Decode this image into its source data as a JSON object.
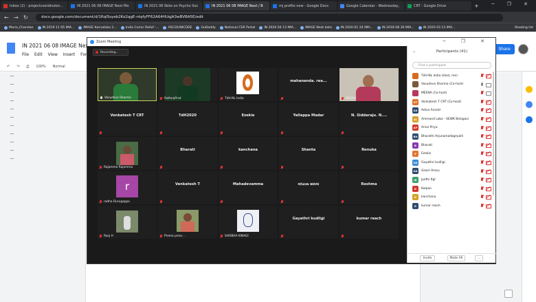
{
  "browser": {
    "tabs": [
      {
        "title": "Inbox (2) - projectcoordinator...",
        "color": "#d93025",
        "active": false
      },
      {
        "title": "IN 2021 06 08 IMAGE Next Mo",
        "color": "#1a73e8",
        "active": false
      },
      {
        "title": "IN 2021 06 Note on Psycho Soc",
        "color": "#1a73e8",
        "active": false
      },
      {
        "title": "IN 2021 06 08 IMAGE Next / B",
        "color": "#1a73e8",
        "active": true
      },
      {
        "title": "mj profile new - Google Docs",
        "color": "#1a73e8",
        "active": false
      },
      {
        "title": "Google Calendar - Wednesday,",
        "color": "#4285f4",
        "active": false
      },
      {
        "title": "CRT - Google Drive",
        "color": "#0f9d58",
        "active": false
      }
    ],
    "new_tab": "+",
    "url": "docs.google.com/document/d/1RqlSsyeb2Ko2qgE-ntqfyFF62A64HUqjA3wBVBA5E/edit",
    "bookmarks": [
      "Maria_Chandan",
      "IN 2019 11 05 IMA...",
      "IMAGE Karnataka 2...",
      "India Comic Relief -...",
      "ASCI2UNICODE",
      "GoDaddy",
      "National CSR Portal",
      "IN 2020 04 13 IMA...",
      "IMAGE Next data",
      "IN 2020-01 24 IMA...",
      "IN 2018 08 30 IMA...",
      "IN 2020 03 13 IMA..."
    ],
    "reading_list": "Reading list",
    "system_time": "11:12",
    "system_date": "09-06-2021",
    "system_lang": "ENG"
  },
  "docs": {
    "title": "IN 2021 06 08 IMAGE Next",
    "menu": [
      "File",
      "Edit",
      "View",
      "Insert",
      "Forma"
    ],
    "zoom": "100%",
    "style": "Normal",
    "share_label": "Share"
  },
  "zoom": {
    "window_title": "Zoom Meeting",
    "recording_label": "Recording...",
    "tiles": [
      {
        "id": "vasudeva",
        "type": "video",
        "label": "Vasudeva Sharma",
        "mic": "on",
        "active": true
      },
      {
        "id": "rathnaprasad",
        "type": "video",
        "label": "RathnaPrsd",
        "mic": "off"
      },
      {
        "id": "tdh",
        "type": "logo",
        "label": "TdH-NL India",
        "mic": "off"
      },
      {
        "id": "mahananda",
        "type": "name",
        "name": "mahananda. rea...",
        "mic": "off"
      },
      {
        "id": "meena",
        "type": "video",
        "label": "MEENA",
        "mic": "off"
      },
      {
        "id": "venkatesh-crt",
        "type": "name",
        "name": "Venkatesh T CRT",
        "mic": "off"
      },
      {
        "id": "tdh2020",
        "type": "name",
        "name": "TdH2020",
        "mic": "off"
      },
      {
        "id": "ezekie",
        "type": "name",
        "name": "Ezekie",
        "mic": "off"
      },
      {
        "id": "yallappa",
        "type": "name",
        "name": "Yallappa Madar",
        "mic": "off"
      },
      {
        "id": "siddaraju",
        "type": "name",
        "name": "N. Siddaraju. N....",
        "mic": "off"
      },
      {
        "id": "rajamma",
        "type": "video",
        "label": "Rajamma Rajamma",
        "mic": "off"
      },
      {
        "id": "bharati",
        "type": "name",
        "name": "Bharati",
        "mic": "off"
      },
      {
        "id": "kanchana",
        "type": "name",
        "name": "kanchana",
        "mic": "off"
      },
      {
        "id": "shanta",
        "type": "name",
        "name": "Shanta",
        "mic": "off"
      },
      {
        "id": "renuka",
        "type": "name",
        "name": "Renuka",
        "mic": "off"
      },
      {
        "id": "radha",
        "type": "avatar",
        "letter": "r",
        "label": "radha Durugappa",
        "mic": "off"
      },
      {
        "id": "venkatesh-t",
        "type": "name",
        "name": "Venkatesh T",
        "mic": "off"
      },
      {
        "id": "mahadevamma",
        "type": "name",
        "name": "Mahadevamma",
        "mic": "off"
      },
      {
        "id": "kannada",
        "type": "name",
        "name": "ಸರೋಜಾ ಹವಳದ",
        "mic": "off"
      },
      {
        "id": "reshma",
        "type": "name",
        "name": "Reshma",
        "mic": "off"
      },
      {
        "id": "rooj",
        "type": "video",
        "label": "Rooj H",
        "mic": "off"
      },
      {
        "id": "prema",
        "type": "video",
        "label": "Prema pmor...",
        "mic": "off"
      },
      {
        "id": "shobha",
        "type": "video",
        "label": "SHOBHA KINAGI",
        "mic": "off"
      },
      {
        "id": "gayathri",
        "type": "name",
        "name": "Gayathri kudligi",
        "mic": "off"
      },
      {
        "id": "kumar",
        "type": "name",
        "name": "kumar reach",
        "mic": "off"
      }
    ],
    "participants": {
      "title": "Participants (41)",
      "search_placeholder": "Find a participant",
      "list": [
        {
          "initials": "",
          "name": "TdH-NL India (Host, me)",
          "color": "#d86a1e",
          "mic": "off",
          "cam": "off"
        },
        {
          "initials": "",
          "name": "Vasudeva Sharma (Co-host)",
          "color": "#7a5a3a",
          "mic": "on",
          "cam": "on"
        },
        {
          "initials": "",
          "name": "MEENA (Co-host)",
          "color": "#b33a5a",
          "mic": "off",
          "cam": "on"
        },
        {
          "initials": "VT",
          "name": "Venkatesh T CRT (Co-host)",
          "color": "#e0742d",
          "mic": "off",
          "cam": "off"
        },
        {
          "initials": "AA",
          "name": "Adiva Arnold",
          "color": "#2e4b6e",
          "mic": "off",
          "cam": "off"
        },
        {
          "initials": "AL",
          "name": "Ammand Lobo - SEWK Belagavi",
          "color": "#d6a128",
          "mic": "off",
          "cam": "off"
        },
        {
          "initials": "AP",
          "name": "Anne Priya",
          "color": "#d33a2a",
          "mic": "off",
          "cam": "off"
        },
        {
          "initials": "BA",
          "name": "Bharathi Arjunamallageyalli",
          "color": "#2e4b6e",
          "mic": "off",
          "cam": "off"
        },
        {
          "initials": "B",
          "name": "Bharati",
          "color": "#8a3ab0",
          "mic": "off",
          "cam": "off"
        },
        {
          "initials": "E",
          "name": "Ezekie",
          "color": "#e0742d",
          "mic": "off",
          "cam": "off"
        },
        {
          "initials": "GK",
          "name": "Gayathri kudligi",
          "color": "#3a8ad6",
          "mic": "off",
          "cam": "off"
        },
        {
          "initials": "GA",
          "name": "Gowri Arasu",
          "color": "#2e4b6e",
          "mic": "off",
          "cam": "off"
        },
        {
          "initials": "JK",
          "name": "Jyothi Kgl",
          "color": "#3aa06a",
          "mic": "off",
          "cam": "off"
        },
        {
          "initials": "K",
          "name": "Kalpan",
          "color": "#d33a2a",
          "mic": "off",
          "cam": "off"
        },
        {
          "initials": "K",
          "name": "kanchana",
          "color": "#d6a128",
          "mic": "off",
          "cam": "off"
        },
        {
          "initials": "K",
          "name": "kumar reach",
          "color": "#2e4b6e",
          "mic": "off",
          "cam": "off"
        }
      ],
      "invite_label": "Invite",
      "mute_all_label": "Mute All",
      "more_label": "..."
    }
  }
}
